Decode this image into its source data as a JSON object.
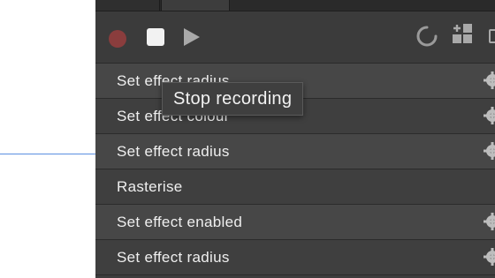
{
  "toolbar": {
    "record_color": "#8a3d3d",
    "stop_color": "#f2f2f2",
    "play_color": "#a9a9a9"
  },
  "tooltip": {
    "text": "Stop recording"
  },
  "steps": [
    {
      "label": "Set effect radius",
      "has_settings": true
    },
    {
      "label": "Set effect colour",
      "has_settings": true
    },
    {
      "label": "Set effect radius",
      "has_settings": true
    },
    {
      "label": "Rasterise",
      "has_settings": false
    },
    {
      "label": "Set effect enabled",
      "has_settings": true
    },
    {
      "label": "Set effect radius",
      "has_settings": true
    }
  ],
  "icons": {
    "record": "record-icon",
    "stop": "stop-icon",
    "play": "play-icon",
    "loop": "loop-icon",
    "new_macro": "add-grid-icon",
    "settings": "gear-icon"
  }
}
